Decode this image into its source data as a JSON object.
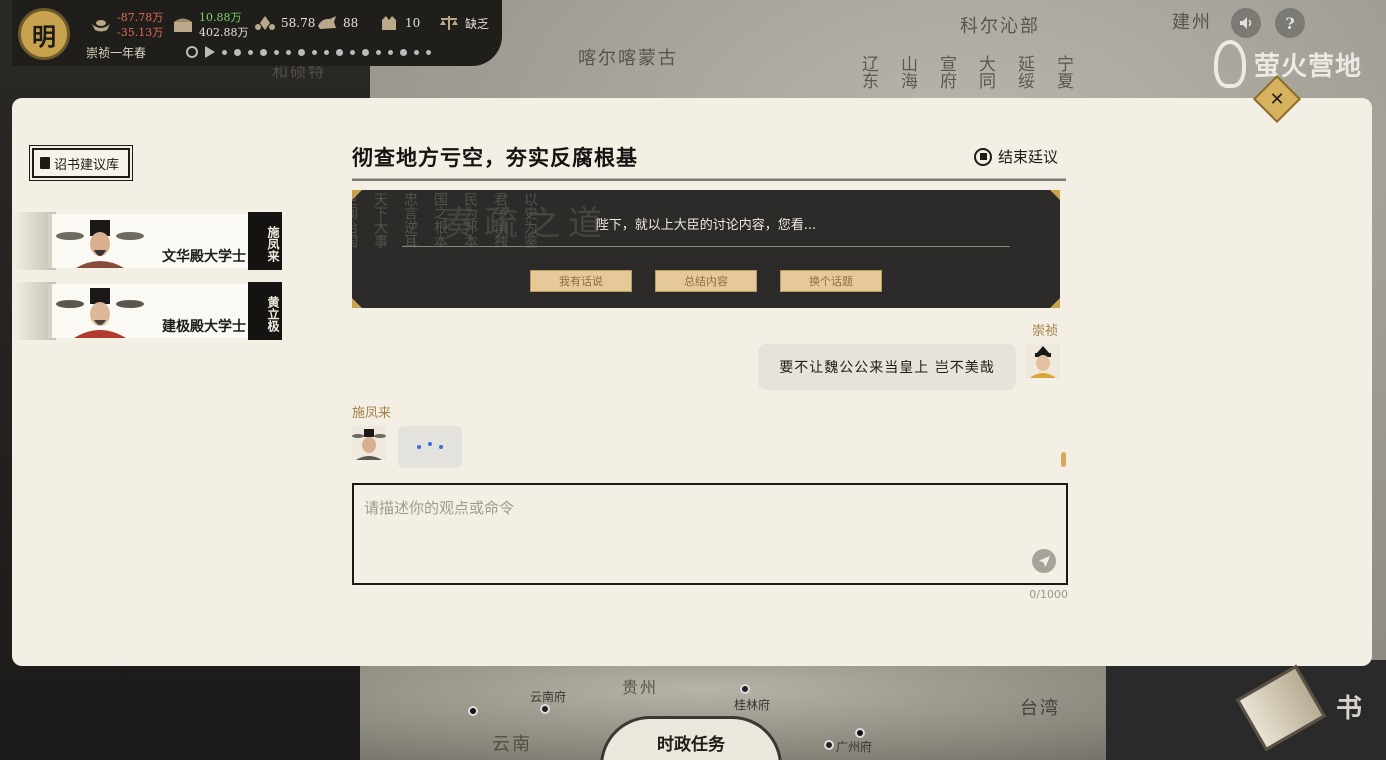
{
  "topbar": {
    "dynasty": "明",
    "gold_delta": "-87.78万",
    "gold_delta2": "-35.13万",
    "treasury_delta": "10.88万",
    "treasury_total": "402.88万",
    "stat_a": "58.78",
    "stat_b": "88",
    "stat_c": "10",
    "stat_d": "缺乏",
    "season": "崇祯一年春"
  },
  "watermark": "萤火营地",
  "map_labels": {
    "kharchin": "喀尔喀蒙古",
    "horqin": "科尔沁部",
    "hohhot": "和硕特",
    "jianzhou": "建州",
    "guizhou": "贵州",
    "yunnan_fu": "云南府",
    "yunnan": "云南",
    "guilin": "桂林府",
    "guangzhou": "广州府",
    "taiwan": "台湾"
  },
  "dialog": {
    "edict_library": "诏书建议库",
    "title": "彻查地方亏空，夯实反腐根基",
    "end_debate": "结束廷议",
    "prompt": "陛下，就以上大臣的讨论内容，您看...",
    "options": [
      "我有话说",
      "总结内容",
      "换个话题"
    ],
    "ministers": [
      {
        "name": "施凤来",
        "title": "文华殿大学士"
      },
      {
        "name": "黄立极",
        "title": "建极殿大学士"
      }
    ],
    "messages": [
      {
        "sender": "崇祯",
        "text": "要不让魏公公来当皇上 岂不美哉"
      },
      {
        "sender": "施凤来",
        "text": ""
      }
    ],
    "input_placeholder": "请描述你的观点或命令",
    "input_value": "",
    "counter": "0/1000"
  },
  "bottom": {
    "task_tab": "时政任务",
    "book_tab": "书"
  },
  "icons": {
    "close": "close-icon",
    "sound": "sound-icon",
    "help": "help-icon",
    "send": "send-icon"
  }
}
